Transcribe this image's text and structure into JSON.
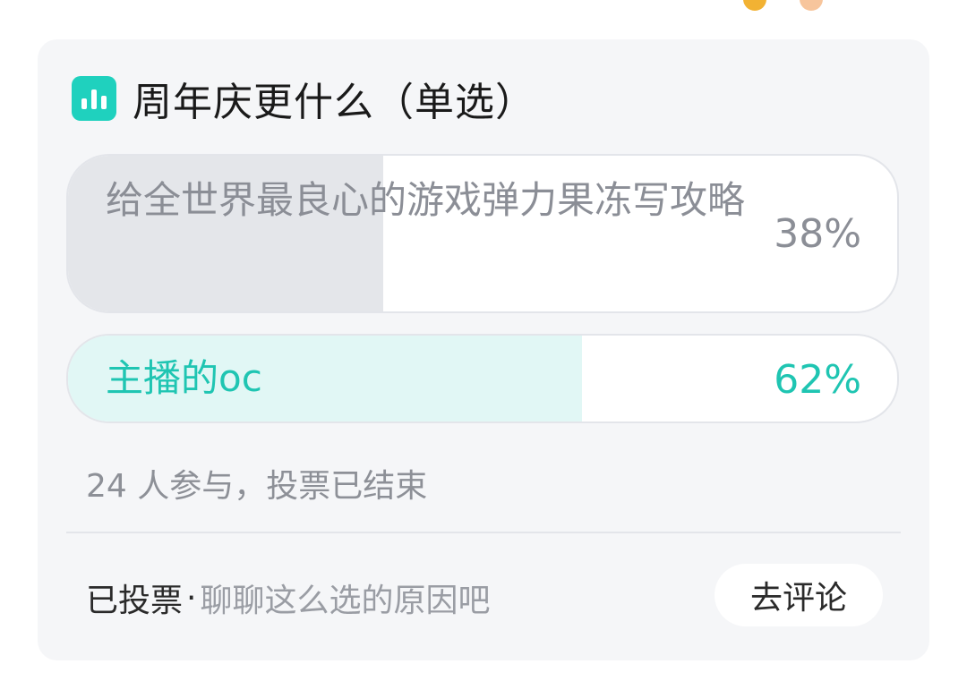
{
  "poll": {
    "title": "周年庆更什么（单选）",
    "options": [
      {
        "label": "给全世界最良心的游戏弹力果冻写攻略",
        "percent_label": "38%",
        "percent": 38,
        "selected": false
      },
      {
        "label": "主播的oc",
        "percent_label": "62%",
        "percent": 62,
        "selected": true
      }
    ],
    "summary": "24 人参与，投票已结束"
  },
  "footer": {
    "voted_label": "已投票",
    "separator": "·",
    "prompt": "聊聊这么选的原因吧",
    "comment_button": "去评论"
  },
  "colors": {
    "accent": "#1fd1be",
    "accent_text": "#1fc5b2",
    "card_bg": "#f5f6f8",
    "muted_text": "#8b8e96"
  },
  "icons": {
    "poll": "poll-bar-chart-icon"
  }
}
